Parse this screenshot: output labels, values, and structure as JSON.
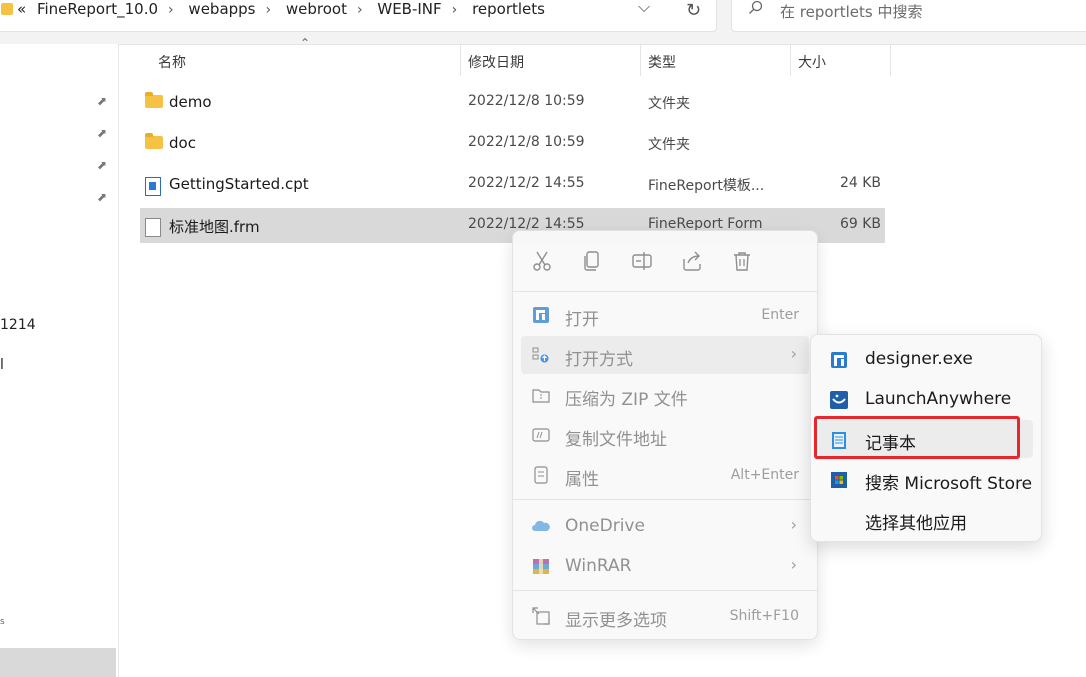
{
  "address": {
    "overflow": "«",
    "crumbs": [
      "FineReport_10.0",
      "webapps",
      "webroot",
      "WEB-INF",
      "reportlets"
    ],
    "separator": "›",
    "dropdown_glyph": "⌵",
    "refresh_glyph": "↻"
  },
  "search": {
    "placeholder": "在 reportlets 中搜索",
    "icon": "search-icon"
  },
  "nav": {
    "items": [
      {
        "label": "1214"
      },
      {
        "label": "l"
      },
      {
        "label": "s"
      }
    ],
    "pin_glyph": "📌"
  },
  "columns": {
    "name": "名称",
    "date": "修改日期",
    "type": "类型",
    "size": "大小",
    "sort_glyph": "⌃"
  },
  "files": [
    {
      "name": "demo",
      "date": "2022/12/8 10:59",
      "type": "文件夹",
      "size": "",
      "icon": "folder-icon"
    },
    {
      "name": "doc",
      "date": "2022/12/8 10:59",
      "type": "文件夹",
      "size": "",
      "icon": "folder-icon"
    },
    {
      "name": "GettingStarted.cpt",
      "date": "2022/12/2 14:55",
      "type": "FineReport模板...",
      "size": "24 KB",
      "icon": "cpt-file-icon"
    },
    {
      "name": "标准地图.frm",
      "date": "2022/12/2 14:55",
      "type": "FineReport Form",
      "size": "69 KB",
      "icon": "frm-file-icon"
    }
  ],
  "context_menu": {
    "toolbar": [
      "cut-icon",
      "copy-icon",
      "rename-icon",
      "share-icon",
      "delete-icon"
    ],
    "items": [
      {
        "label": "打开",
        "shortcut": "Enter",
        "icon": "finereport-icon"
      },
      {
        "label": "打开方式",
        "shortcut": "",
        "icon": "open-with-icon",
        "arrow": "›"
      },
      {
        "label": "压缩为 ZIP 文件",
        "shortcut": "",
        "icon": "zip-icon"
      },
      {
        "label": "复制文件地址",
        "shortcut": "",
        "icon": "copy-path-icon"
      },
      {
        "label": "属性",
        "shortcut": "Alt+Enter",
        "icon": "properties-icon"
      },
      {
        "label": "OneDrive",
        "shortcut": "",
        "icon": "onedrive-icon",
        "arrow": "›"
      },
      {
        "label": "WinRAR",
        "shortcut": "",
        "icon": "winrar-icon",
        "arrow": "›"
      },
      {
        "label": "显示更多选项",
        "shortcut": "Shift+F10",
        "icon": "more-options-icon"
      }
    ]
  },
  "submenu": {
    "items": [
      {
        "label": "designer.exe",
        "icon": "designer-icon"
      },
      {
        "label": "LaunchAnywhere",
        "icon": "launchanywhere-icon"
      },
      {
        "label": "记事本",
        "icon": "notepad-icon"
      },
      {
        "label": "搜索 Microsoft Store",
        "icon": "store-icon"
      },
      {
        "label": "选择其他应用",
        "icon": ""
      }
    ]
  },
  "colors": {
    "highlight": "#e8262b",
    "selection": "#d9d9d9",
    "folder": "#f6c244",
    "accent": "#2a7ad0"
  }
}
